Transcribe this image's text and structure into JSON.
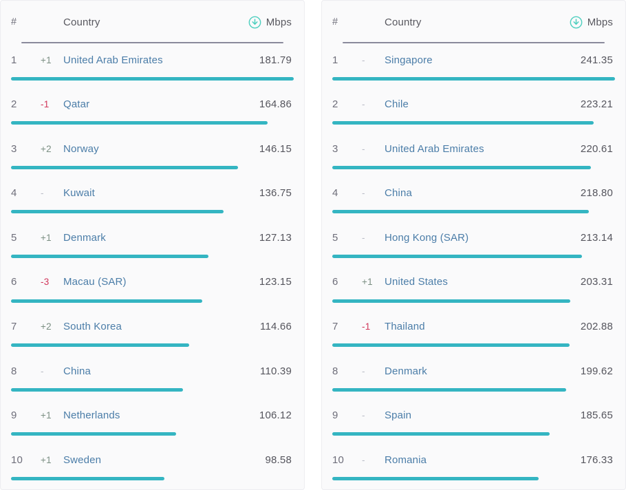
{
  "icons": {
    "download": "download-circle-icon"
  },
  "colors": {
    "bar": "#34b5c2",
    "country_link": "#4b7da8",
    "rank_up": "#7b8f83",
    "rank_down": "#d1365a",
    "rank_flat": "#b9bcc6",
    "header_rule": "#8a8a9c",
    "panel_bg": "#fafafb",
    "value_text": "#55555d"
  },
  "panels": [
    {
      "id": "left-ranking-panel",
      "name": "mobile-speed-ranking",
      "columns": {
        "rank": "#",
        "delta": "",
        "country": "Country",
        "unit": "Mbps"
      },
      "max_value": 181.79,
      "rows": [
        {
          "rank": "1",
          "delta": "+1",
          "delta_dir": "up",
          "country": "United Arab Emirates",
          "value": "181.79"
        },
        {
          "rank": "2",
          "delta": "-1",
          "delta_dir": "down",
          "country": "Qatar",
          "value": "164.86"
        },
        {
          "rank": "3",
          "delta": "+2",
          "delta_dir": "up",
          "country": "Norway",
          "value": "146.15"
        },
        {
          "rank": "4",
          "delta": "-",
          "delta_dir": "flat",
          "country": "Kuwait",
          "value": "136.75"
        },
        {
          "rank": "5",
          "delta": "+1",
          "delta_dir": "up",
          "country": "Denmark",
          "value": "127.13"
        },
        {
          "rank": "6",
          "delta": "-3",
          "delta_dir": "down",
          "country": "Macau (SAR)",
          "value": "123.15"
        },
        {
          "rank": "7",
          "delta": "+2",
          "delta_dir": "up",
          "country": "South Korea",
          "value": "114.66"
        },
        {
          "rank": "8",
          "delta": "-",
          "delta_dir": "flat",
          "country": "China",
          "value": "110.39"
        },
        {
          "rank": "9",
          "delta": "+1",
          "delta_dir": "up",
          "country": "Netherlands",
          "value": "106.12"
        },
        {
          "rank": "10",
          "delta": "+1",
          "delta_dir": "up",
          "country": "Sweden",
          "value": "98.58"
        }
      ]
    },
    {
      "id": "right-ranking-panel",
      "name": "fixed-broadband-speed-ranking",
      "columns": {
        "rank": "#",
        "delta": "",
        "country": "Country",
        "unit": "Mbps"
      },
      "max_value": 241.35,
      "rows": [
        {
          "rank": "1",
          "delta": "-",
          "delta_dir": "flat",
          "country": "Singapore",
          "value": "241.35"
        },
        {
          "rank": "2",
          "delta": "-",
          "delta_dir": "flat",
          "country": "Chile",
          "value": "223.21"
        },
        {
          "rank": "3",
          "delta": "-",
          "delta_dir": "flat",
          "country": "United Arab Emirates",
          "value": "220.61"
        },
        {
          "rank": "4",
          "delta": "-",
          "delta_dir": "flat",
          "country": "China",
          "value": "218.80"
        },
        {
          "rank": "5",
          "delta": "-",
          "delta_dir": "flat",
          "country": "Hong Kong (SAR)",
          "value": "213.14"
        },
        {
          "rank": "6",
          "delta": "+1",
          "delta_dir": "up",
          "country": "United States",
          "value": "203.31"
        },
        {
          "rank": "7",
          "delta": "-1",
          "delta_dir": "down",
          "country": "Thailand",
          "value": "202.88"
        },
        {
          "rank": "8",
          "delta": "-",
          "delta_dir": "flat",
          "country": "Denmark",
          "value": "199.62"
        },
        {
          "rank": "9",
          "delta": "-",
          "delta_dir": "flat",
          "country": "Spain",
          "value": "185.65"
        },
        {
          "rank": "10",
          "delta": "-",
          "delta_dir": "flat",
          "country": "Romania",
          "value": "176.33"
        }
      ]
    }
  ],
  "chart_data": [
    {
      "type": "bar",
      "title": "",
      "xlabel": "Mbps",
      "ylabel": "Country",
      "categories": [
        "United Arab Emirates",
        "Qatar",
        "Norway",
        "Kuwait",
        "Denmark",
        "Macau (SAR)",
        "South Korea",
        "China",
        "Netherlands",
        "Sweden"
      ],
      "values": [
        181.79,
        164.86,
        146.15,
        136.75,
        127.13,
        123.15,
        114.66,
        110.39,
        106.12,
        98.58
      ],
      "xlim": [
        0,
        181.79
      ],
      "grid": false,
      "legend": "none"
    },
    {
      "type": "bar",
      "title": "",
      "xlabel": "Mbps",
      "ylabel": "Country",
      "categories": [
        "Singapore",
        "Chile",
        "United Arab Emirates",
        "China",
        "Hong Kong (SAR)",
        "United States",
        "Thailand",
        "Denmark",
        "Spain",
        "Romania"
      ],
      "values": [
        241.35,
        223.21,
        220.61,
        218.8,
        213.14,
        203.31,
        202.88,
        199.62,
        185.65,
        176.33
      ],
      "xlim": [
        0,
        241.35
      ],
      "grid": false,
      "legend": "none"
    }
  ]
}
